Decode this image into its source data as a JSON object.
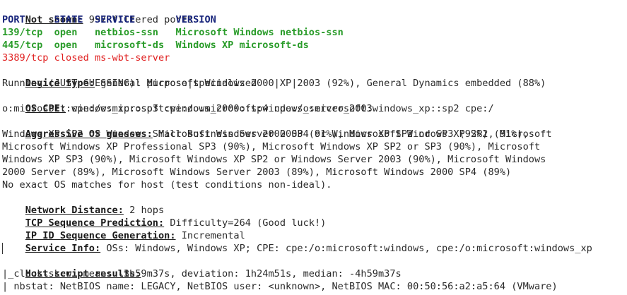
{
  "not_shown": {
    "label": "Not shown:",
    "value": " 997 filtered ports"
  },
  "ports_header": "PORT     STATE  SERVICE       VERSION",
  "ports": [
    {
      "text": "139/tcp  open   netbios-ssn   Microsoft Windows netbios-ssn",
      "state": "open"
    },
    {
      "text": "445/tcp  open   microsoft-ds  Windows XP microsoft-ds",
      "state": "open"
    },
    {
      "text": "3389/tcp closed ms-wbt-server",
      "state": "closed"
    }
  ],
  "device_type": {
    "label": "Device type:",
    "value": " general purpose|specialized"
  },
  "running": "Running (JUST GUESSING): Microsoft Windows 2000|XP|2003 (92%), General Dynamics embedded (88%)",
  "os_cpe": {
    "label": "OS CPE:",
    "value_line1": " cpe:/o:microsoft:windows_2000::sp4 cpe:/o:microsoft:windows_xp::sp2 cpe:/",
    "value_line2": "o:microsoft:windows_xp::sp3 cpe:/o:microsoft:windows_server_2003"
  },
  "aggressive": {
    "label": "Aggressive OS guesses:",
    "line1": " Microsoft Windows 2000 SP4 or Windows XP SP2 or SP3 (92%), Microsoft",
    "line2": "Windows XP SP2 or Windows Small Business Server 2003 (91%), Microsoft Windows XP SP2 (91%),",
    "line3": "Microsoft Windows XP Professional SP3 (90%), Microsoft Windows XP SP2 or SP3 (90%), Microsoft",
    "line4": "Windows XP SP3 (90%), Microsoft Windows XP SP2 or Windows Server 2003 (90%), Microsoft Windows",
    "line5": "2000 Server (89%), Microsoft Windows Server 2003 (89%), Microsoft Windows 2000 SP4 (89%)"
  },
  "no_exact": "No exact OS matches for host (test conditions non-ideal).",
  "network_distance": {
    "label": "Network Distance:",
    "value": " 2 hops"
  },
  "tcp_seq": {
    "label": "TCP Sequence Prediction:",
    "value": " Difficulty=264 (Good luck!)"
  },
  "ipid_seq": {
    "label": "IP ID Sequence Generation:",
    "value": " Incremental"
  },
  "service_info": {
    "label": "Service Info:",
    "value": " OSs: Windows, Windows XP; CPE: cpe:/o:microsoft:windows, cpe:/o:microsoft:windows_xp"
  },
  "host_script": {
    "label": "Host script results:"
  },
  "clock_skew": "|_clock-skew: mean: -3h59m37s, deviation: 1h24m51s, median: -4h59m37s",
  "nbstat": "| nbstat: NetBIOS name: LEGACY, NetBIOS user: <unknown>, NetBIOS MAC: 00:50:56:a2:a5:64 (VMware)",
  "colors": {
    "open": "#2a9c2a",
    "closed": "#e02020",
    "header": "#16237a",
    "background": "#ffffff"
  }
}
